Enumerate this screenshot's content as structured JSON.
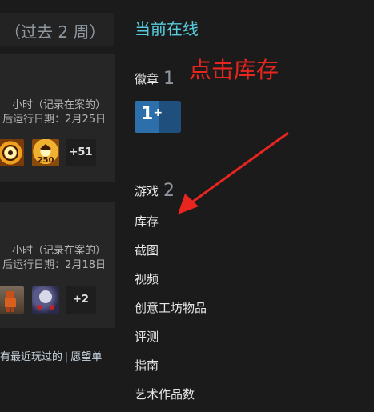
{
  "left": {
    "recent_header": "（过去 2 周）",
    "cards": [
      {
        "hours": "小时（记录在案的）",
        "last_run": "后运行日期：2月25日",
        "more": "+51"
      },
      {
        "hours": "小时（记录在案的）",
        "last_run": "后运行日期：2月18日",
        "more": "+2"
      }
    ],
    "bottom_links": {
      "recent": "有最近玩过的",
      "sep": "|",
      "wishlist": "愿望单"
    }
  },
  "right": {
    "online_status": "当前在线",
    "annotation": "点击库存",
    "badges": {
      "label": "徽章",
      "count": "1"
    },
    "badge_text": "1",
    "badge_plus": "+",
    "games": {
      "label": "游戏",
      "count": "2"
    },
    "nav": {
      "inventory": "库存",
      "screenshots": "截图",
      "videos": "视频",
      "workshop": "创意工坊物品",
      "reviews": "评测",
      "guides": "指南",
      "artwork": "艺术作品数"
    }
  },
  "colors": {
    "background": "#1b1b1b",
    "online": "#57cbde",
    "annotation": "#e8251f",
    "badge": "#2d6faa"
  }
}
